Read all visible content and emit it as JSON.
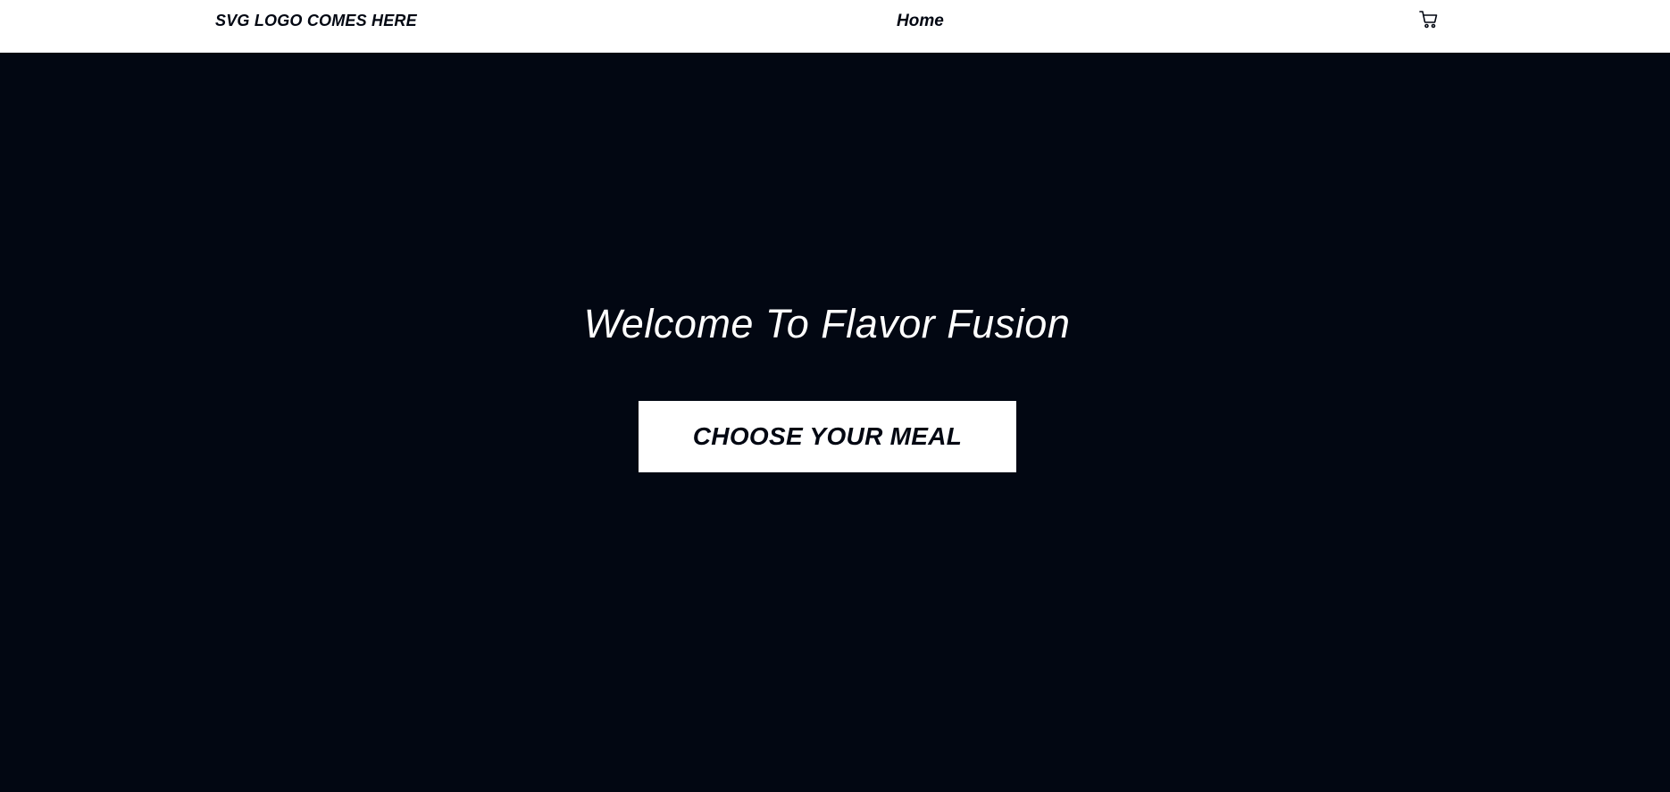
{
  "header": {
    "logo_text": "SVG LOGO COMES HERE",
    "nav": {
      "home_label": "Home"
    },
    "cart_icon": "shopping-cart-icon"
  },
  "hero": {
    "title": "Welcome To Flavor Fusion",
    "cta_label": "CHOOSE YOUR MEAL"
  },
  "colors": {
    "background": "#020712",
    "header_background": "#ffffff",
    "text_dark": "#020712",
    "text_light": "#ffffff"
  }
}
